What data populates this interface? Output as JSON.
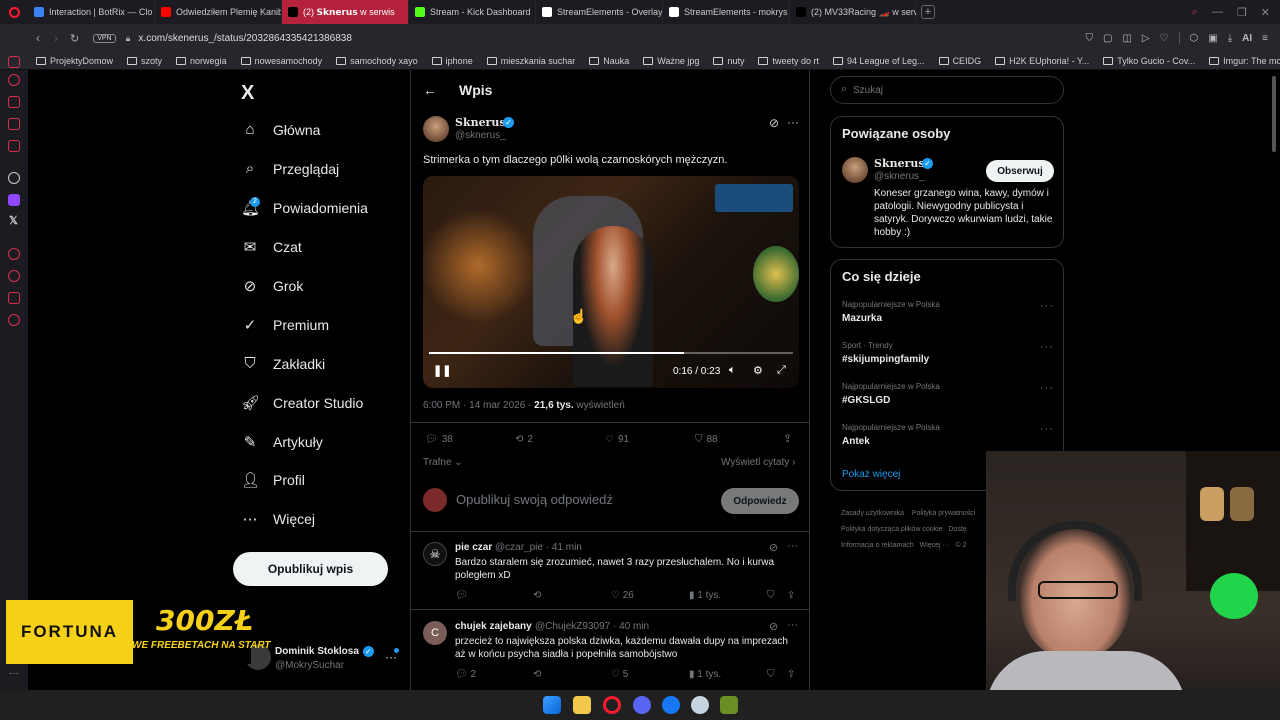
{
  "tabs": [
    {
      "label": "Interaction | BotRix — Clo",
      "color": "#3b82f6"
    },
    {
      "label": "Odwiedziłem Plemię Kanib",
      "color": "#ff0000"
    },
    {
      "label": "(2) 𝗦𝗸𝗻𝗲𝗿𝘂𝘀 w serwis",
      "color": "#000000",
      "active": true
    },
    {
      "label": "Stream - Kick Dashboard",
      "color": "#53fc18"
    },
    {
      "label": "StreamElements - Overlay",
      "color": "#ffffff"
    },
    {
      "label": "StreamElements - mokrys",
      "color": "#ffffff"
    },
    {
      "label": "(2) MV33Racing 🏎️ w serw",
      "color": "#000000"
    }
  ],
  "address": {
    "vpn": "VPN",
    "url": "x.com/skenerus_/status/2032864335421386838",
    "ai": "AI"
  },
  "bookmarks": [
    "ProjektyDomow",
    "szoty",
    "norwegia",
    "nowesamochody",
    "samochody xayo",
    "iphone",
    "mieszkania suchar",
    "Nauka",
    "Ważne jpg",
    "nuty",
    "tweety do rt",
    "94 League of Leg...",
    "CEIDG",
    "H2K EUphoria! - Y...",
    "Tylko Gucio - Cov...",
    "Imgur: The most a..."
  ],
  "nav": {
    "logo": "X",
    "items": [
      "Główna",
      "Przeglądaj",
      "Powiadomienia",
      "Czat",
      "Grok",
      "Premium",
      "Zakładki",
      "Creator Studio",
      "Artykuły",
      "Profil",
      "Więcej"
    ],
    "notif_badge": "2",
    "post_button": "Opublikuj wpis",
    "account": {
      "name": "Dominik Stoklosa",
      "handle": "@MokrySuchar"
    }
  },
  "post": {
    "header": "Wpis",
    "author": "Sknerus",
    "handle": "@sknerus_",
    "text": "Strimerka o tym dlaczego p0lki wolą czarnoskórych mężczyzn.",
    "video": {
      "time": "0:16 / 0:23",
      "progress": 0.7
    },
    "meta_time": "6:00 PM · 14 mar 2026 · ",
    "views": "21,6 tys.",
    "views_label": " wyświetleń",
    "stats": {
      "replies": "38",
      "reposts": "2",
      "likes": "91",
      "bookmarks": "88"
    },
    "sort": "Trafne",
    "quotes_link": "Wyświetl cytaty"
  },
  "reply_box": {
    "placeholder": "Opublikuj swoją odpowiedź",
    "button": "Odpowiedz"
  },
  "replies": [
    {
      "author": "pie czar",
      "handle": "@czar_pie · 41 min",
      "text": "Bardzo staralem się zrozumieć, nawet 3 razy przesłuchalem. No i kurwa poległem xD",
      "likes": "26",
      "views": "1 tys.",
      "avatar_color": "#ffffff"
    },
    {
      "author": "chujek zajebany",
      "handle": "@ChujekZ93097 · 40 min",
      "text": "przecież to największa polska dziwka, każdemu dawała dupy na imprezach aż w końcu psycha siadła i popełniła samobójstwo",
      "replies": "2",
      "likes": "5",
      "views": "1 tys.",
      "avatar_letter": "C",
      "avatar_color": "#7b5d57"
    }
  ],
  "search": {
    "placeholder": "Szukaj"
  },
  "related": {
    "title": "Powiązane osoby",
    "name": "Sknerus",
    "handle": "@sknerus_",
    "follow": "Obserwuj",
    "bio": "Koneser grzanego wina, kawy, dymów i patologii. Niewygodny publicysta i satyryk. Dorywczo wkurwiam ludzi, takie hobby :)"
  },
  "trending": {
    "title": "Co się dzieje",
    "items": [
      {
        "context": "Najpopularniejsze w Polska",
        "topic": "Mazurka"
      },
      {
        "context": "Sport · Trendy",
        "topic": "#skijumpingfamily"
      },
      {
        "context": "Najpopularniejsze w Polska",
        "topic": "#GKSLGD"
      },
      {
        "context": "Najpopularniejsze w Polska",
        "topic": "Antek"
      }
    ],
    "more": "Pokaż więcej"
  },
  "footer_links": [
    "Zasady użytkownika",
    "Polityka prywatności",
    "Polityka dotycząca plików cookie",
    "Dostę",
    "Informacja o reklamach",
    "Więcej ···",
    "© 2"
  ],
  "ad": {
    "brand": "FORTUNA",
    "amount": "300ZŁ",
    "tagline": "WE FREEBETACH NA START"
  },
  "colors": {
    "accent": "#1d9bf0",
    "border": "#2f3336",
    "muted": "#71767b",
    "ad_yellow": "#f7d117"
  }
}
